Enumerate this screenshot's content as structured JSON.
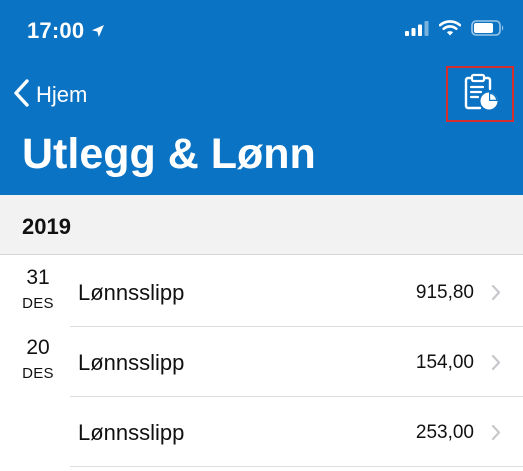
{
  "colors": {
    "accent": "#0a73c4",
    "highlight_box": "#d32f2f",
    "section_bg": "#f2f2f2",
    "chevron": "#c7c7cc"
  },
  "status_bar": {
    "time": "17:00",
    "icons": [
      "location-arrow-icon",
      "cellular-signal-icon",
      "wifi-icon",
      "battery-icon"
    ]
  },
  "nav": {
    "back_label": "Hjem",
    "back_icon": "chevron-left-icon",
    "report_icon": "clipboard-chart-icon"
  },
  "page": {
    "title": "Utlegg & Lønn"
  },
  "section": {
    "year": "2019"
  },
  "rows": [
    {
      "day": "31",
      "month": "DES",
      "label": "Lønnsslipp",
      "amount": "915,80"
    },
    {
      "day": "20",
      "month": "DES",
      "label": "Lønnsslipp",
      "amount": "154,00"
    },
    {
      "day": "",
      "month": "",
      "label": "Lønnsslipp",
      "amount": "253,00"
    }
  ]
}
